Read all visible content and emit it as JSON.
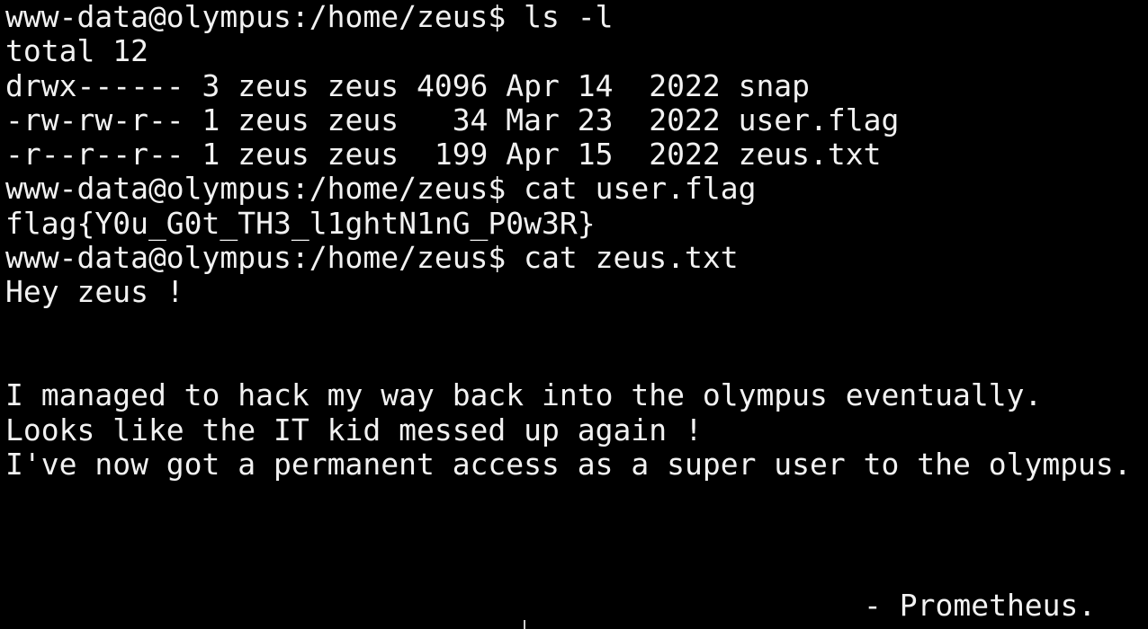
{
  "terminal": {
    "background_color": "#000000",
    "text_color": "#f2f2f2",
    "prompt": "www-data@olympus:/home/zeus$ ",
    "commands": {
      "ls": "ls -l",
      "cat_flag": "cat user.flag",
      "cat_txt": "cat zeus.txt"
    },
    "ls_output": {
      "total": "total 12",
      "rows": [
        "drwx------ 3 zeus zeus 4096 Apr 14  2022 snap",
        "-rw-rw-r-- 1 zeus zeus   34 Mar 23  2022 user.flag",
        "-r--r--r-- 1 zeus zeus  199 Apr 15  2022 zeus.txt"
      ]
    },
    "flag_output": "flag{Y0u_G0t_TH3_l1ghtN1nG_P0w3R}",
    "zeus_txt": {
      "greeting": "Hey zeus !",
      "lines": [
        "I managed to hack my way back into the olympus eventually.",
        "Looks like the IT kid messed up again !",
        "I've now got a permanent access as a super user to the olympus."
      ],
      "signature": "- Prometheus."
    }
  }
}
